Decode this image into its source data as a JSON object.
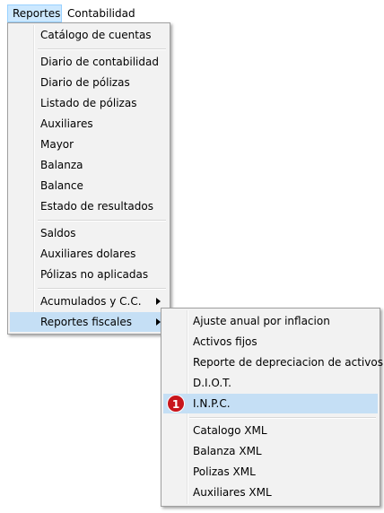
{
  "menubar": {
    "items": [
      {
        "label": "Reportes"
      },
      {
        "label": "Contabilidad"
      }
    ]
  },
  "reportes_menu": {
    "items": [
      {
        "label": "Catálogo de cuentas"
      },
      {
        "label": "Diario de contabilidad"
      },
      {
        "label": "Diario de pólizas"
      },
      {
        "label": "Listado de pólizas"
      },
      {
        "label": "Auxiliares"
      },
      {
        "label": "Mayor"
      },
      {
        "label": "Balanza"
      },
      {
        "label": "Balance"
      },
      {
        "label": "Estado de resultados"
      },
      {
        "label": "Saldos"
      },
      {
        "label": "Auxiliares dolares"
      },
      {
        "label": "Pólizas no aplicadas"
      },
      {
        "label": "Acumulados y C.C."
      },
      {
        "label": "Reportes fiscales"
      }
    ]
  },
  "fiscales_submenu": {
    "items": [
      {
        "label": "Ajuste anual por inflacion"
      },
      {
        "label": "Activos fijos"
      },
      {
        "label": "Reporte de depreciacion de activos"
      },
      {
        "label": "D.I.O.T."
      },
      {
        "label": "I.N.P.C."
      },
      {
        "label": "Catalogo XML"
      },
      {
        "label": "Balanza XML"
      },
      {
        "label": "Polizas XML"
      },
      {
        "label": "Auxiliares XML"
      }
    ]
  },
  "annotation": {
    "step": "1"
  },
  "colors": {
    "highlight": "#c5dff5",
    "menubar_selected": "#cce8ff",
    "badge": "#c8161d"
  }
}
